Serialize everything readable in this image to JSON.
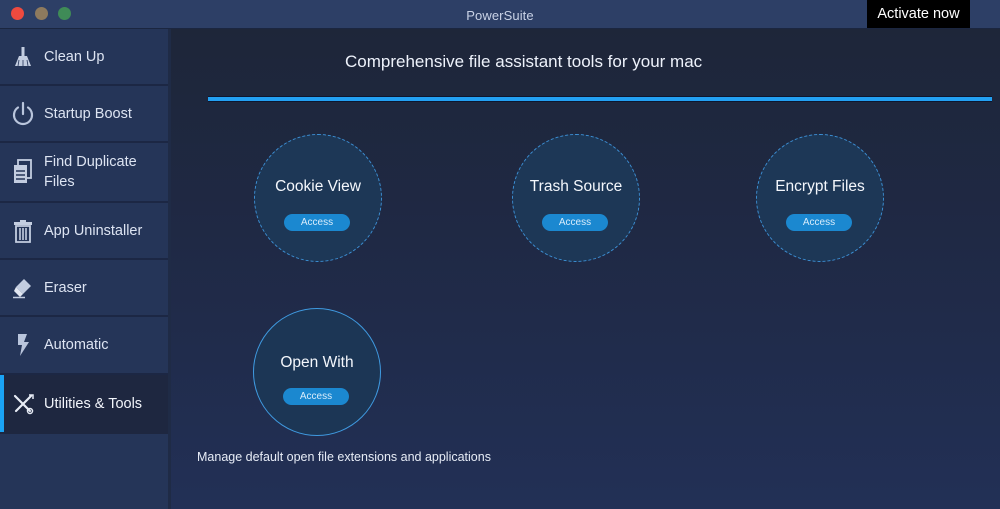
{
  "window": {
    "title": "PowerSuite",
    "activate_label": "Activate now"
  },
  "sidebar": {
    "items": [
      {
        "label": "Clean Up",
        "icon": "broom-icon",
        "active": false
      },
      {
        "label": "Startup Boost",
        "icon": "power-icon",
        "active": false
      },
      {
        "label": "Find Duplicate Files",
        "label_line1": "Find Duplicate",
        "label_line2": "Files",
        "icon": "duplicate-files-icon",
        "active": false
      },
      {
        "label": "App Uninstaller",
        "icon": "trash-icon",
        "active": false
      },
      {
        "label": "Eraser",
        "icon": "eraser-icon",
        "active": false
      },
      {
        "label": "Automatic",
        "icon": "lightning-icon",
        "active": false
      },
      {
        "label": "Utilities & Tools",
        "icon": "tools-icon",
        "active": true
      }
    ]
  },
  "main": {
    "headline": "Comprehensive file assistant tools for your mac",
    "progress_percent": 100,
    "tools": [
      {
        "name": "Cookie View",
        "button": "Access",
        "selected": false
      },
      {
        "name": "Trash Source",
        "button": "Access",
        "selected": false
      },
      {
        "name": "Encrypt Files",
        "button": "Access",
        "selected": false
      },
      {
        "name": "Open With",
        "button": "Access",
        "selected": true
      }
    ],
    "selected_tool_description": "Manage default open file extensions and applications"
  },
  "colors": {
    "accent": "#1aa3f5",
    "progress": "#23a0f2",
    "access_button": "#1b88d0",
    "activate_bg": "#000000"
  }
}
